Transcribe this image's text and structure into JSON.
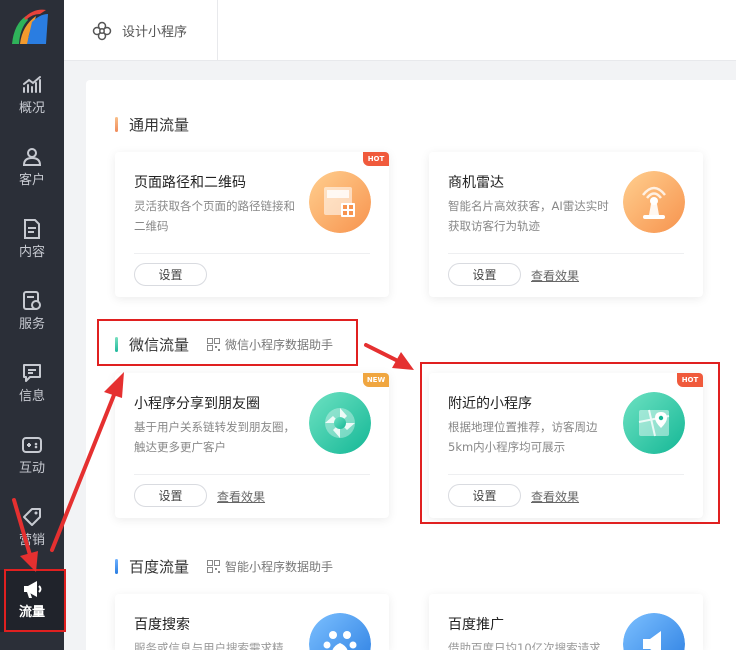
{
  "sidebar": {
    "items": [
      {
        "label": "概况",
        "icon": "chart-icon"
      },
      {
        "label": "客户",
        "icon": "user-icon"
      },
      {
        "label": "内容",
        "icon": "document-icon"
      },
      {
        "label": "服务",
        "icon": "service-icon"
      },
      {
        "label": "信息",
        "icon": "message-icon"
      },
      {
        "label": "互动",
        "icon": "gamepad-icon"
      },
      {
        "label": "营销",
        "icon": "tag-icon"
      },
      {
        "label": "流量",
        "icon": "megaphone-icon"
      }
    ]
  },
  "header": {
    "tab_label": "设计小程序",
    "tab_icon": "flower-icon"
  },
  "sections": [
    {
      "title": "通用流量",
      "accent": "#f5a36c"
    },
    {
      "title": "微信流量",
      "accent": "#2ec4b6",
      "helper": "微信小程序数据助手"
    },
    {
      "title": "百度流量",
      "accent": "#3a8ef0",
      "helper": "智能小程序数据助手"
    }
  ],
  "cards": [
    {
      "title": "页面路径和二维码",
      "desc": "灵活获取各个页面的路径链接和二维码",
      "button": "设置",
      "badge": "HOT",
      "icon": "qrcode-page-icon"
    },
    {
      "title": "商机雷达",
      "desc": "智能名片高效获客，AI雷达实时获取访客行为轨迹",
      "button": "设置",
      "link": "查看效果",
      "icon": "radar-icon"
    },
    {
      "title": "小程序分享到朋友圈",
      "desc": "基于用户关系链转发到朋友圈，触达更多更广客户",
      "button": "设置",
      "link": "查看效果",
      "badge": "NEW",
      "icon": "moments-icon"
    },
    {
      "title": "附近的小程序",
      "desc": "根据地理位置推荐，访客周边5km内小程序均可展示",
      "button": "设置",
      "link": "查看效果",
      "badge": "HOT",
      "icon": "map-pin-icon"
    },
    {
      "title": "百度搜索",
      "desc": "服务或信息与用户搜索需求精",
      "icon": "paw-icon"
    },
    {
      "title": "百度推广",
      "desc": "借助百度日均10亿次搜索请求",
      "icon": "speaker-icon"
    }
  ],
  "colors": {
    "sidebar": "#2b2f38",
    "highlight": "#e02020",
    "hot_badge": "#f05a3c",
    "new_badge": "#f0a640"
  }
}
